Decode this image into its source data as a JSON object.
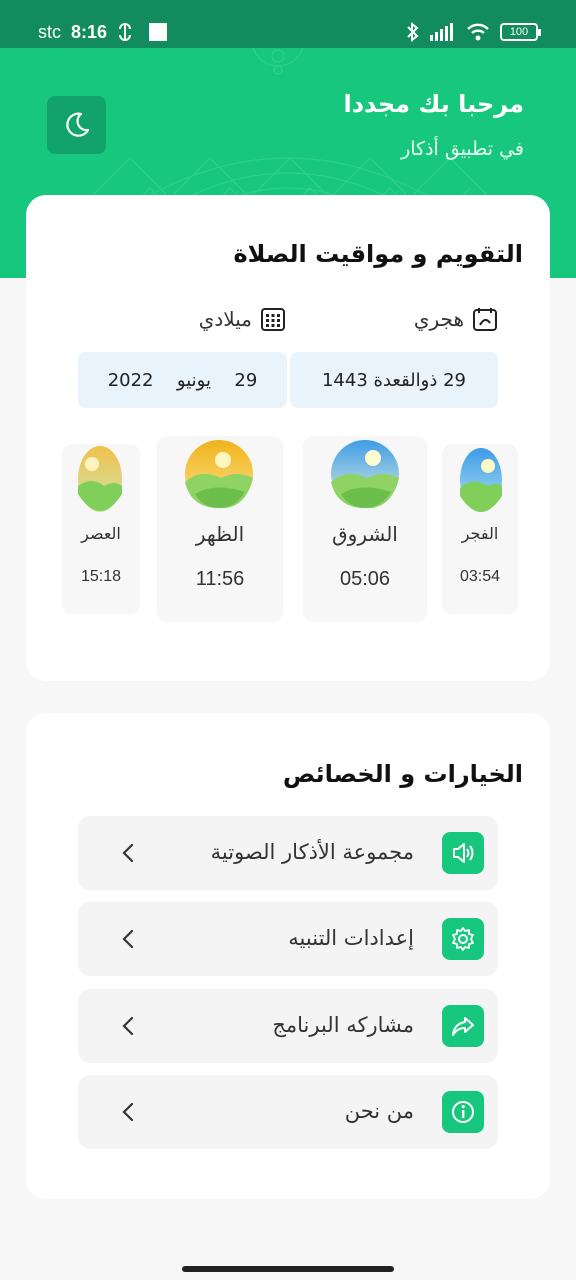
{
  "status_bar": {
    "carrier": "stc",
    "time": "8:16",
    "battery": "100"
  },
  "header": {
    "title": "مرحبا بك مجددا",
    "subtitle": "في تطبيق أذكار",
    "theme_icon": "moon-icon"
  },
  "calendar": {
    "title": "التقويم و مواقيت الصلاة",
    "hijri_label": "هجري",
    "gregorian_label": "ميلادي",
    "hijri_date": "29 ذوالقعدة 1443",
    "gregorian_day": "29",
    "gregorian_month": "يونيو",
    "gregorian_year": "2022"
  },
  "prayers": [
    {
      "name": "الفجر",
      "time": "03:54"
    },
    {
      "name": "الشروق",
      "time": "05:06"
    },
    {
      "name": "الظهر",
      "time": "11:56"
    },
    {
      "name": "العصر",
      "time": "15:18"
    }
  ],
  "options": {
    "title": "الخيارات و الخصائص",
    "items": [
      {
        "label": "مجموعة الأذكار الصوتية",
        "icon": "speaker-icon"
      },
      {
        "label": "إعدادات التنبيه",
        "icon": "gear-icon"
      },
      {
        "label": "مشاركه البرنامج",
        "icon": "share-icon"
      },
      {
        "label": "من نحن",
        "icon": "info-icon"
      }
    ]
  },
  "colors": {
    "primary": "#17c77e",
    "status_bar": "#128c5e",
    "date_box": "#e8f3fb"
  }
}
